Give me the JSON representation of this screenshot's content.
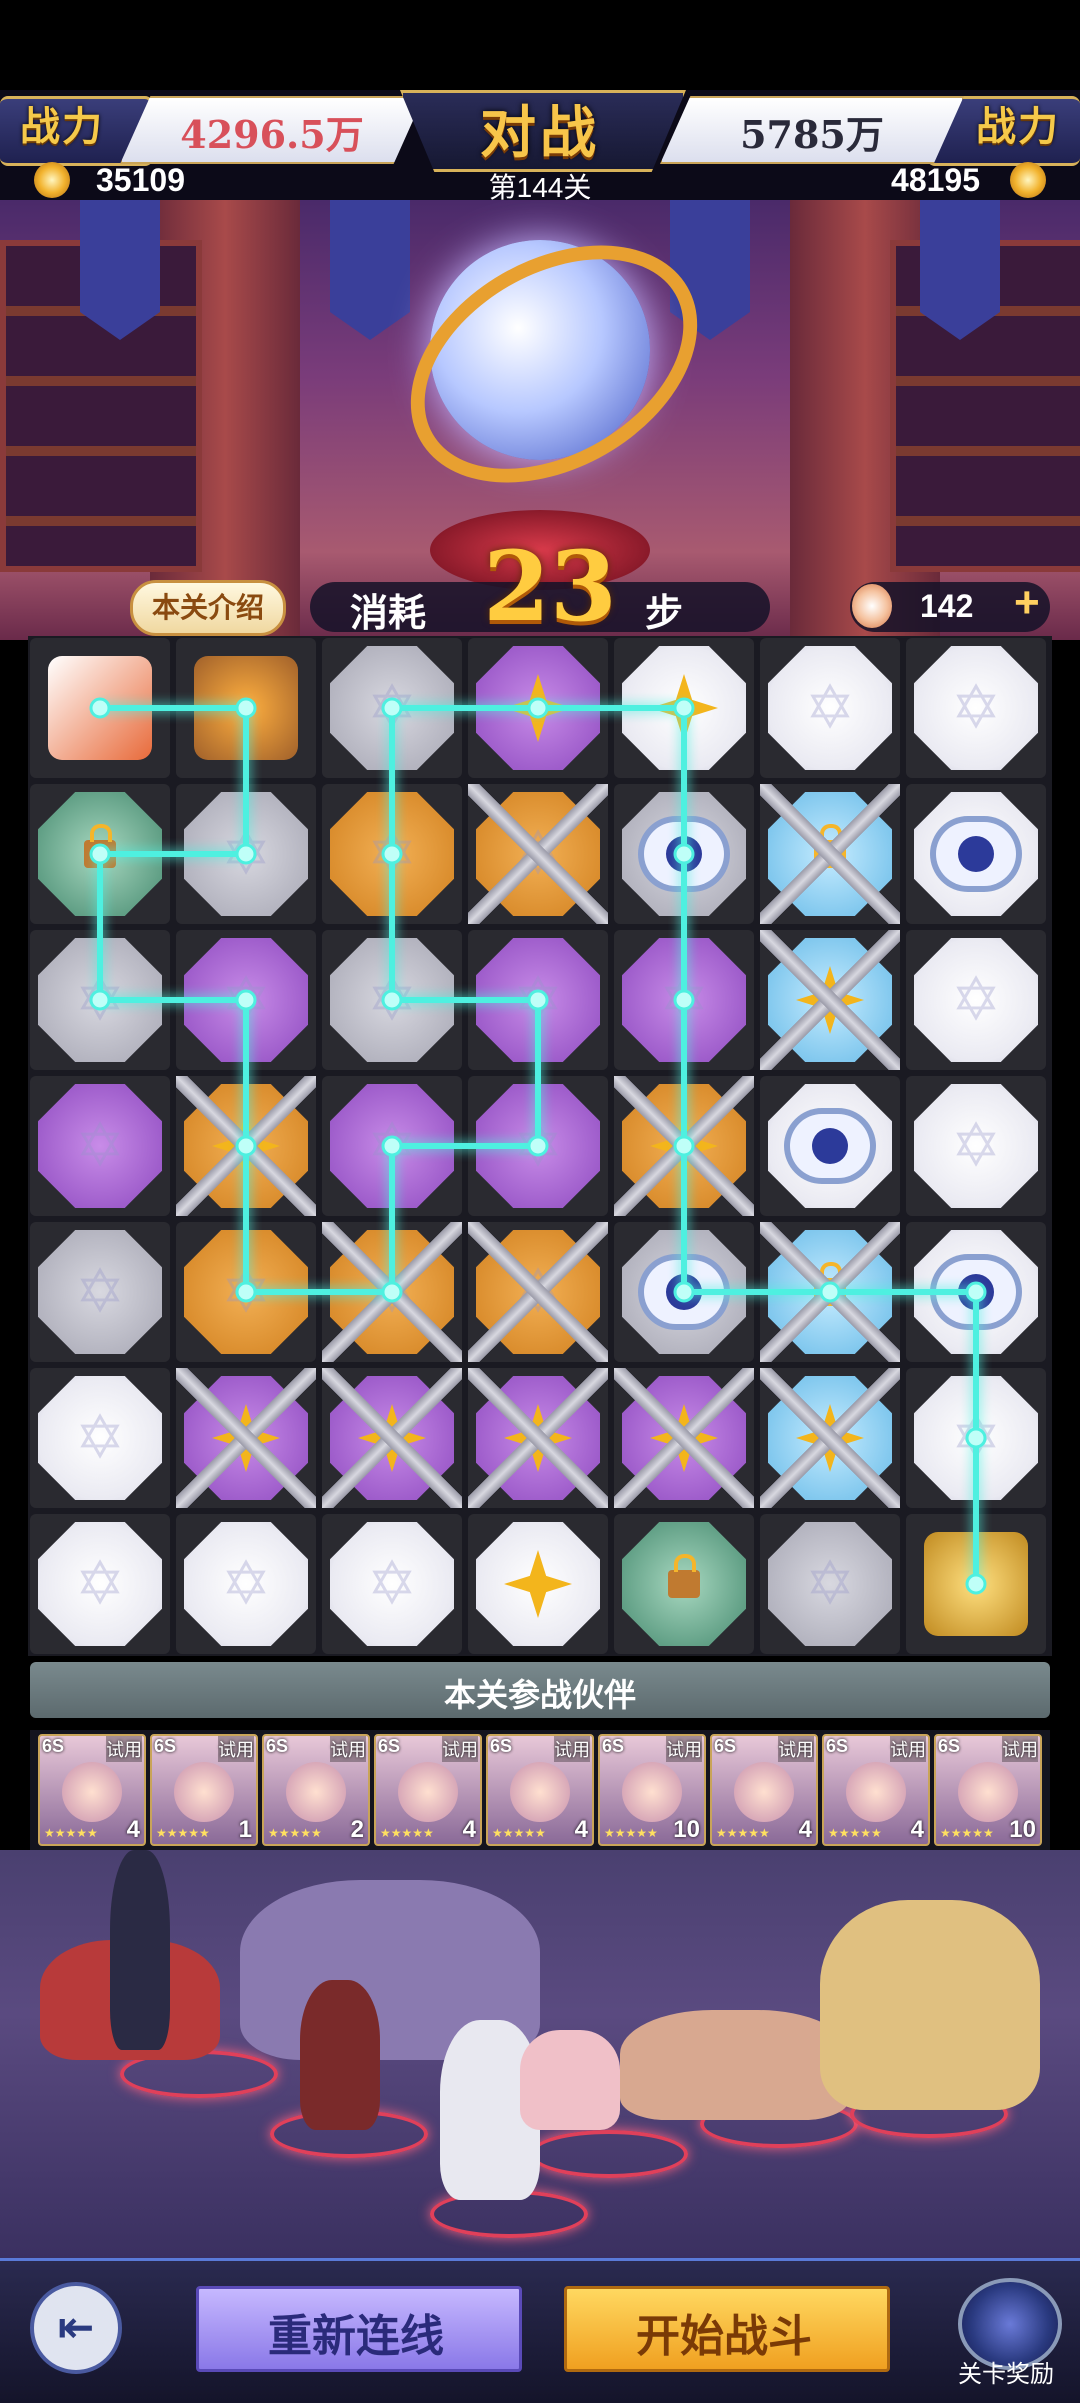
{
  "header": {
    "power_label_left": "战力",
    "power_label_right": "战力",
    "power_left": "4296.5万",
    "power_right": "5785万",
    "battle_title": "对战",
    "coins_left": "35109",
    "coins_right": "48195",
    "level": "第144关"
  },
  "steps": {
    "intro_label": "本关介绍",
    "label": "消耗",
    "count": "23",
    "unit": "步"
  },
  "energy": {
    "value": "142",
    "plus": "+"
  },
  "board": {
    "rows": 7,
    "cols": 7,
    "tiles": [
      [
        "rocket",
        "torch",
        "grey",
        "purple-bolt",
        "white-bolt",
        "white",
        "white"
      ],
      [
        "green-lantern",
        "grey",
        "orange",
        "orange-chain",
        "grey-cloud",
        "blue-lock-chain",
        "white-cloud"
      ],
      [
        "grey",
        "purple",
        "grey",
        "purple",
        "purple",
        "blue-bolt-chain",
        "white"
      ],
      [
        "purple",
        "orange-bolt-chain",
        "purple",
        "purple",
        "orange-bolt-chain",
        "white-cloud",
        "white"
      ],
      [
        "grey",
        "orange",
        "orange-chain",
        "orange-chain",
        "grey-cloud",
        "blue-lock-chain",
        "white-cloud"
      ],
      [
        "white",
        "purple-bolt-chain",
        "purple-bolt-chain",
        "purple-bolt-chain",
        "purple-bolt-chain",
        "blue-bolt-chain",
        "white"
      ],
      [
        "white",
        "white",
        "white",
        "white-bolt",
        "green-lantern",
        "grey",
        "trophy"
      ]
    ],
    "path": [
      [
        0,
        0
      ],
      [
        1,
        0
      ],
      [
        1,
        1
      ],
      [
        0,
        1
      ],
      [
        0,
        2
      ],
      [
        1,
        2
      ],
      [
        1,
        3
      ],
      [
        1,
        4
      ],
      [
        2,
        4
      ],
      [
        2,
        3
      ],
      [
        3,
        3
      ],
      [
        3,
        2
      ],
      [
        2,
        2
      ],
      [
        2,
        1
      ],
      [
        2,
        0
      ],
      [
        3,
        0
      ],
      [
        4,
        0
      ],
      [
        4,
        1
      ],
      [
        4,
        2
      ],
      [
        4,
        3
      ],
      [
        4,
        4
      ],
      [
        5,
        4
      ],
      [
        6,
        4
      ],
      [
        6,
        5
      ],
      [
        6,
        6
      ]
    ],
    "path_color": "#4ef0e0"
  },
  "partners": {
    "title": "本关参战伙伴",
    "cards": [
      {
        "tier": "6S",
        "trial": "试用",
        "level": "4",
        "stars": "★★★★★"
      },
      {
        "tier": "6S",
        "trial": "试用",
        "level": "1",
        "stars": "★★★★★"
      },
      {
        "tier": "6S",
        "trial": "试用",
        "level": "2",
        "stars": "★★★★★"
      },
      {
        "tier": "6S",
        "trial": "试用",
        "level": "4",
        "stars": "★★★★★"
      },
      {
        "tier": "6S",
        "trial": "试用",
        "level": "4",
        "stars": "★★★★★"
      },
      {
        "tier": "6S",
        "trial": "试用",
        "level": "10",
        "stars": "★★★★★"
      },
      {
        "tier": "6S",
        "trial": "试用",
        "level": "4",
        "stars": "★★★★★"
      },
      {
        "tier": "6S",
        "trial": "试用",
        "level": "4",
        "stars": "★★★★★"
      },
      {
        "tier": "6S",
        "trial": "试用",
        "level": "10",
        "stars": "★★★★★"
      }
    ],
    "collapse_icon": "chevron-down-icon"
  },
  "buttons": {
    "rewire": "重新连线",
    "start": "开始战斗",
    "reward": "关卡奖励",
    "back_icon": "back-arrow-icon"
  },
  "colors": {
    "accent_gold": "#f7c54a",
    "power_left": "#d8505a",
    "rewire": "#8a78e8",
    "start": "#f0a020"
  }
}
